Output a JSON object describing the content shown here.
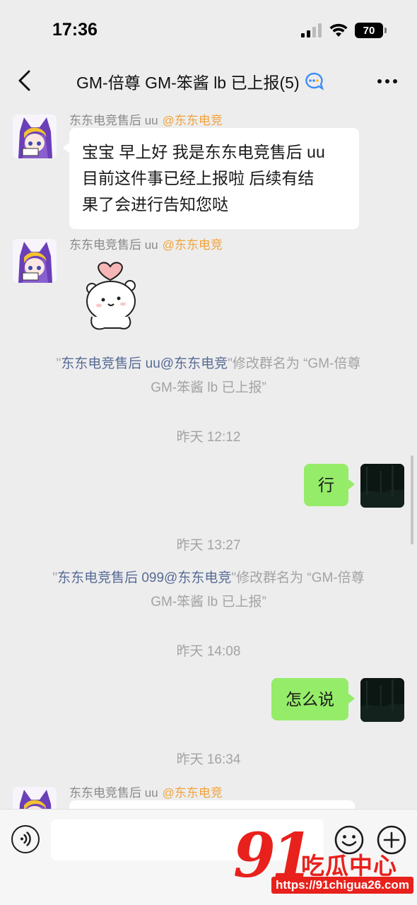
{
  "status": {
    "time": "17:36",
    "battery": "70"
  },
  "nav": {
    "title": "GM-倍尊 GM-笨酱  lb 已上报(5)"
  },
  "messages": {
    "m1": {
      "sender": "东东电竞售后 uu",
      "tag": "@东东电竞",
      "text_line1": "宝宝 早上好 我是东东电竞售后 uu",
      "text_line2": "目前这件事已经上报啦 后续有结",
      "text_line3": "果了会进行告知您哒"
    },
    "m2": {
      "sender": "东东电竞售后 uu",
      "tag": "@东东电竞"
    },
    "sys1": {
      "q_open": "\"",
      "link": "东东电竞售后 uu@东东电竞",
      "q_close": "\"",
      "rest": "修改群名为 “GM-倍尊",
      "line2": "GM-笨酱  lb 已上报”"
    },
    "time1": "昨天 12:12",
    "me1": {
      "text": "行"
    },
    "time2": "昨天 13:27",
    "sys2": {
      "q_open": "\"",
      "link": "东东电竞售后 099@东东电竞",
      "q_close": "\"",
      "rest": "修改群名为 “GM-倍尊",
      "line2": "GM-笨酱  lb 已上报”"
    },
    "time3": "昨天 14:08",
    "me2": {
      "text": "怎么说"
    },
    "time4": "昨天 16:34",
    "m3": {
      "sender": "东东电竞售后 uu",
      "tag": "@东东电竞"
    }
  },
  "input": {
    "placeholder": ""
  },
  "watermark": {
    "number": "91",
    "name": "吃瓜中心",
    "url": "https://91chigua26.com"
  },
  "icons": [
    "back-arrow-icon",
    "more-dots-icon",
    "ai-chat-icon",
    "voice-icon",
    "emoji-icon",
    "plus-icon",
    "wifi-icon",
    "signal-icon",
    "battery-icon"
  ],
  "colors": {
    "bubble_me": "#95ec69",
    "link": "#576b95",
    "tag": "#f0a33c",
    "watermark": "#e8211c"
  }
}
